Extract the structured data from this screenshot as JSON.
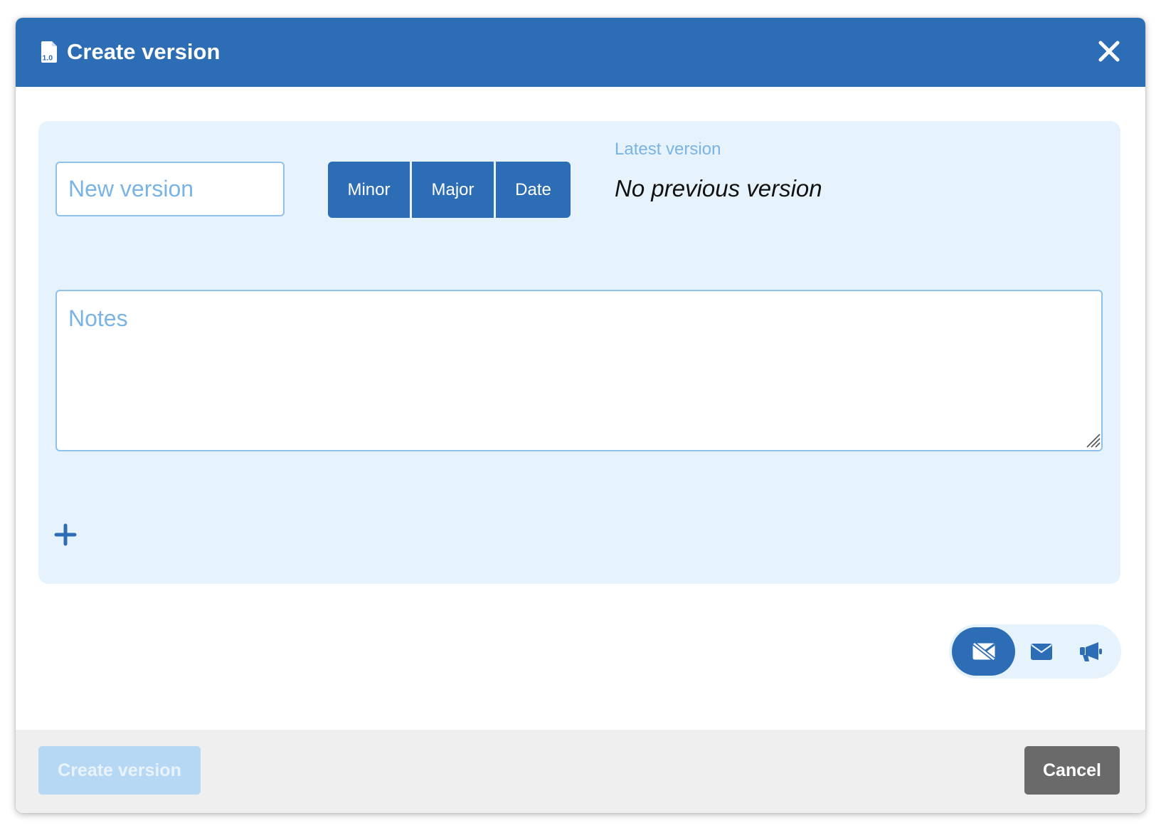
{
  "dialog": {
    "title": "Create version",
    "title_icon": "file-version-icon",
    "close_icon": "close-icon"
  },
  "form": {
    "version_placeholder": "New version",
    "version_value": "",
    "increment_buttons": [
      "Minor",
      "Major",
      "Date"
    ],
    "latest_version_label": "Latest version",
    "latest_version_value": "No previous version",
    "notes_placeholder": "Notes",
    "notes_value": "",
    "add_icon": "plus-icon"
  },
  "notification": {
    "options": [
      {
        "icon": "no-email-icon",
        "active": true
      },
      {
        "icon": "email-icon",
        "active": false
      },
      {
        "icon": "megaphone-icon",
        "active": false
      }
    ]
  },
  "footer": {
    "create_label": "Create version",
    "create_disabled": true,
    "cancel_label": "Cancel"
  },
  "colors": {
    "primary": "#2d6db5",
    "panel_bg": "#e6f2fc",
    "placeholder": "#7ab4e6",
    "disabled_button": "#b6d8f4",
    "cancel_button": "#6a6a6a"
  }
}
